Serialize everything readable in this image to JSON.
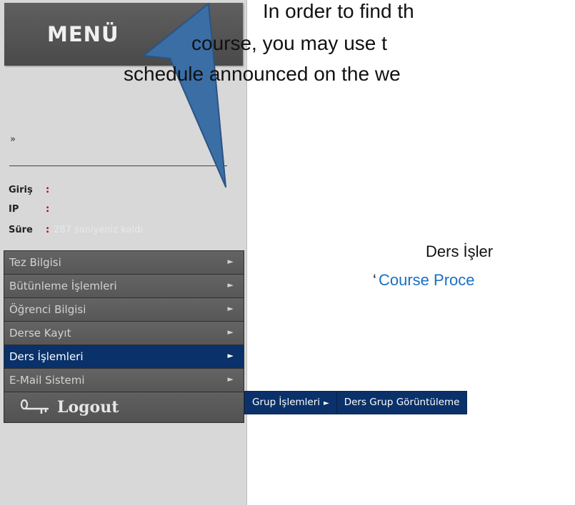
{
  "instruction": {
    "line1": "In   order   to   find   th",
    "line2": "course, you may use t",
    "line3": "schedule announced on the we"
  },
  "annotation": {
    "ders_text": "Ders İşler",
    "course_quote": "‘",
    "course_link": "Course Proce"
  },
  "sidebar": {
    "menu_title": "MENÜ",
    "raquo": "»",
    "info": {
      "giris_label": "Giriş",
      "ip_label": "IP",
      "sure_label": "Süre",
      "colon": ":",
      "remaining_text": "287 saniyeniz kaldı"
    },
    "items": [
      {
        "label": "Tez Bilgisi",
        "arrow": "►"
      },
      {
        "label": "Bütünleme İşlemleri",
        "arrow": "►"
      },
      {
        "label": "Öğrenci Bilgisi",
        "arrow": "►"
      },
      {
        "label": "Derse Kayıt",
        "arrow": "►"
      },
      {
        "label": "Ders İşlemleri",
        "arrow": "►"
      },
      {
        "label": "E-Mail Sistemi",
        "arrow": "►"
      }
    ],
    "active_index": 4,
    "logout_label": "Logout"
  },
  "submenu": {
    "items": [
      {
        "label": "Grup İşlemleri",
        "arrow": "►"
      },
      {
        "label": "Ders Grup Görüntüleme",
        "arrow": ""
      }
    ]
  },
  "colors": {
    "active": "#0a3169",
    "callout": "#3b6ea5",
    "link": "#1a6fc4"
  },
  "icons": {
    "logout": "key-icon",
    "arrow": "triangle-right-icon"
  }
}
